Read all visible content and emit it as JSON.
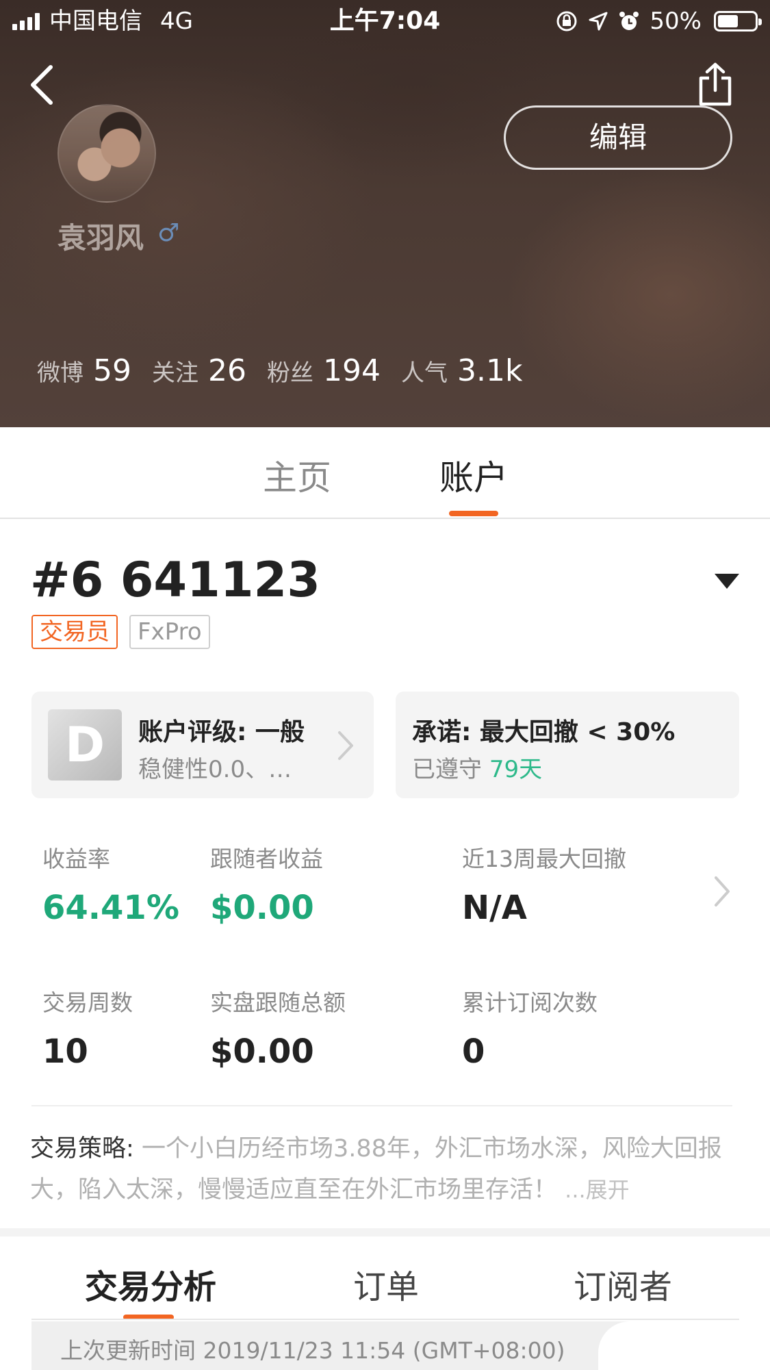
{
  "status_bar": {
    "carrier": "中国电信",
    "network": "4G",
    "time": "上午7:04",
    "battery": "50%",
    "battery_level": 0.5
  },
  "header": {
    "edit_label": "编辑",
    "username": "袁羽风",
    "gender_symbol": "♂",
    "stats": [
      {
        "label": "微博",
        "value": "59"
      },
      {
        "label": "关注",
        "value": "26"
      },
      {
        "label": "粉丝",
        "value": "194"
      },
      {
        "label": "人气",
        "value": "3.1k"
      }
    ]
  },
  "top_tabs": [
    {
      "label": "主页",
      "active": false
    },
    {
      "label": "账户",
      "active": true
    }
  ],
  "account": {
    "number": "#6 641123",
    "tags": [
      "交易员",
      "FxPro"
    ],
    "rating_card": {
      "grade": "D",
      "title": "账户评级: 一般",
      "subtitle": "稳健性0.0、…"
    },
    "promise_card": {
      "title": "承诺: 最大回撤 < 30%",
      "kept_prefix": "已遵守",
      "kept_days": "79天"
    },
    "metrics": [
      {
        "label": "收益率",
        "value": "64.41%"
      },
      {
        "label": "跟随者收益",
        "value": "$0.00"
      },
      {
        "label": "近13周最大回撤",
        "value": "N/A"
      },
      {
        "label": "交易周数",
        "value": "10"
      },
      {
        "label": "实盘跟随总额",
        "value": "$0.00"
      },
      {
        "label": "累计订阅次数",
        "value": "0"
      }
    ],
    "strategy": {
      "label": "交易策略:",
      "text": "一个小白历经市场3.88年，外汇市场水深，风险大回报大，陷入太深，慢慢适应直至在外汇市场里存活！",
      "more": "...展开"
    }
  },
  "bottom_tabs": [
    {
      "label": "交易分析",
      "active": true
    },
    {
      "label": "订单",
      "active": false
    },
    {
      "label": "订阅者",
      "active": false
    }
  ],
  "update_info": "上次更新时间 2019/11/23 11:54 (GMT+08:00)",
  "colors": {
    "accent": "#f26522",
    "positive": "#1fa879",
    "days": "#2db98a"
  }
}
